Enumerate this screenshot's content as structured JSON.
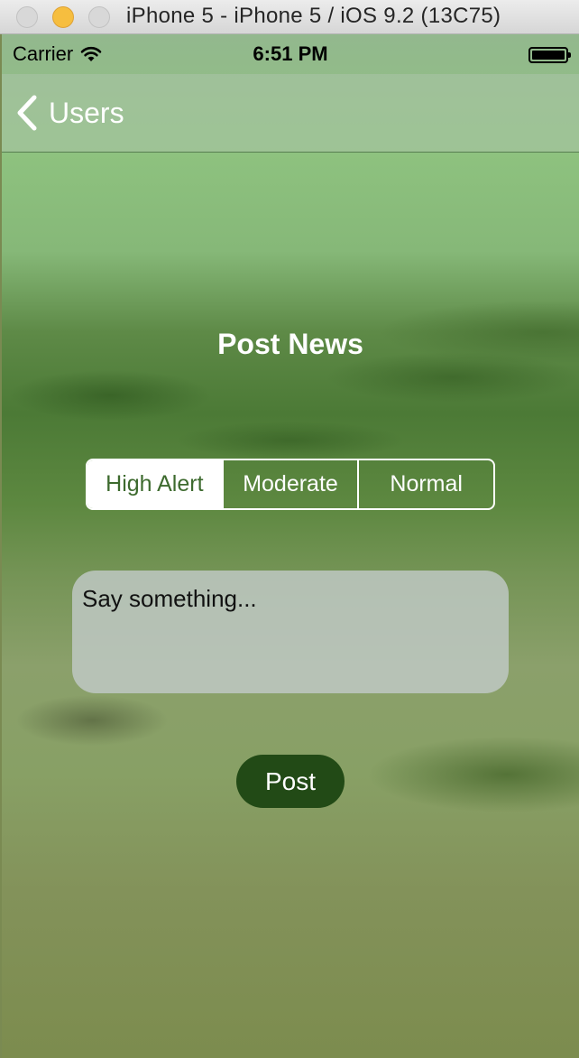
{
  "window": {
    "title": "iPhone 5 - iPhone 5 / iOS 9.2 (13C75)"
  },
  "status_bar": {
    "carrier": "Carrier",
    "time": "6:51 PM",
    "wifi_icon": "wifi-icon",
    "battery_icon": "battery-icon"
  },
  "navbar": {
    "back_label": "Users",
    "back_icon": "chevron-left-icon"
  },
  "main": {
    "title": "Post News",
    "priority_segments": [
      {
        "label": "High Alert",
        "selected": true
      },
      {
        "label": "Moderate",
        "selected": false
      },
      {
        "label": "Normal",
        "selected": false
      }
    ],
    "message_placeholder": "Say something...",
    "post_label": "Post"
  },
  "colors": {
    "post_button": "#224a16",
    "selected_segment_text": "#3d6a2e",
    "traffic_minimize": "#f6be3f"
  }
}
